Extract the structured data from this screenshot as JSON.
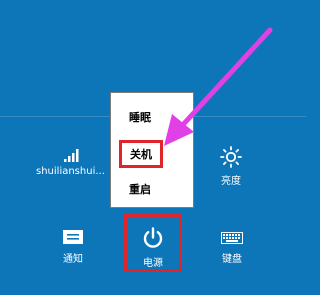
{
  "quick_settings": {
    "network_label": "shuilianshui...",
    "brightness_label": "亮度",
    "notifications_label": "通知",
    "power_label": "电源",
    "keyboard_label": "键盘"
  },
  "power_menu": {
    "sleep": "睡眠",
    "shutdown": "关机",
    "restart": "重启"
  },
  "icons": {
    "network": "wifi-signal-icon",
    "brightness": "sun-icon",
    "notifications": "notification-icon",
    "power": "power-icon",
    "keyboard": "keyboard-icon"
  },
  "colors": {
    "background": "#0d76b8",
    "highlight": "#e1232a",
    "annotation_arrow": "#e040e6"
  }
}
